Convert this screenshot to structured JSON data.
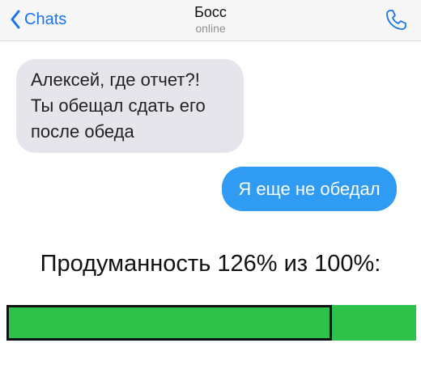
{
  "header": {
    "back_label": "Chats",
    "title": "Босс",
    "subtitle": "online"
  },
  "messages": [
    {
      "direction": "incoming",
      "lines": [
        "Алексей, где отчет?!",
        "Ты обещал сдать его",
        "после обеда"
      ]
    },
    {
      "direction": "outgoing",
      "text": "Я еще не обедал"
    }
  ],
  "caption": "Продуманность 126% из 100%:",
  "progress": {
    "value_percent": 126,
    "max_percent": 100,
    "fill_color": "#2fc24a",
    "box_border_color": "#111111"
  },
  "colors": {
    "accent": "#1a73e8",
    "incoming_bubble": "#e6e5eb",
    "outgoing_bubble": "#2f9bf3"
  },
  "icons": {
    "back": "chevron-left-icon",
    "call": "phone-icon"
  }
}
